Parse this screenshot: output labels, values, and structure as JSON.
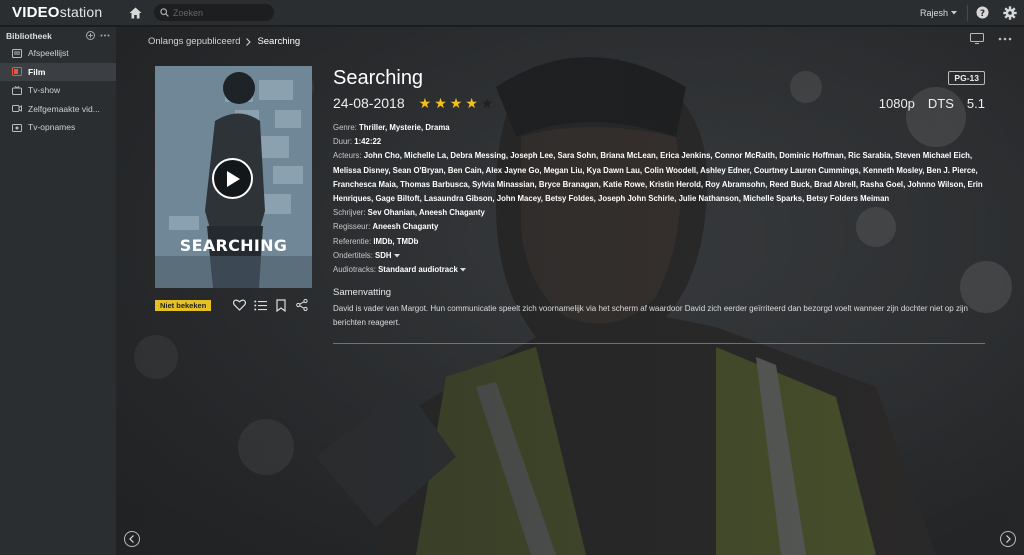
{
  "app": {
    "logo_bold": "VIDEO",
    "logo_rest": "station"
  },
  "topbar": {
    "search_placeholder": "Zoeken",
    "user": "Rajesh"
  },
  "sidebar": {
    "header": "Bibliotheek",
    "items": [
      {
        "label": "Afspeellijst",
        "icon": "playlist-icon",
        "active": false
      },
      {
        "label": "Film",
        "icon": "film-icon",
        "active": true
      },
      {
        "label": "Tv-show",
        "icon": "tv-icon",
        "active": false
      },
      {
        "label": "Zelfgemaakte vid...",
        "icon": "home-video-icon",
        "active": false
      },
      {
        "label": "Tv-opnames",
        "icon": "tv-recording-icon",
        "active": false
      }
    ]
  },
  "breadcrumb": {
    "parent": "Onlangs gepubliceerd",
    "current": "Searching"
  },
  "poster": {
    "title": "SEARCHING"
  },
  "status_badge": "Niet bekeken",
  "movie": {
    "title": "Searching",
    "content_rating": "PG-13",
    "date": "24-08-2018",
    "rating": {
      "value": 4,
      "max": 5
    },
    "resolution": "1080p",
    "audio_format": "DTS",
    "channels": "5.1",
    "genre_label": "Genre:",
    "genre": "Thriller, Mysterie, Drama",
    "duration_label": "Duur:",
    "duration": "1:42:22",
    "actors_label": "Acteurs:",
    "actors": "John Cho, Michelle La, Debra Messing, Joseph Lee, Sara Sohn, Briana McLean, Erica Jenkins, Connor McRaith, Dominic Hoffman, Ric Sarabia, Steven Michael Eich, Melissa Disney, Sean O'Bryan, Ben Cain, Alex Jayne Go, Megan Liu, Kya Dawn Lau, Colin Woodell, Ashley Edner, Courtney Lauren Cummings, Kenneth Mosley, Ben J. Pierce, Franchesca Maia, Thomas Barbusca, Sylvia Minassian, Bryce Branagan, Katie Rowe, Kristin Herold, Roy Abramsohn, Reed Buck, Brad Abrell, Rasha Goel, Johnno Wilson, Erin Henriques, Gage Biltoft, Lasaundra Gibson, John Macey, Betsy Foldes, Joseph John Schirle, Julie Nathanson, Michelle Sparks, Betsy Folders Meiman",
    "writer_label": "Schrijver:",
    "writer": "Sev Ohanian, Aneesh Chaganty",
    "director_label": "Regisseur:",
    "director": "Aneesh Chaganty",
    "reference_label": "Referentie:",
    "reference": "IMDb, TMDb",
    "subtitles_label": "Ondertitels:",
    "subtitles": "SDH",
    "audiotracks_label": "Audiotracks:",
    "audiotracks": "Standaard audiotrack",
    "summary_heading": "Samenvatting",
    "summary": "David is vader van Margot. Hun communicatie speelt zich voornamelijk via het scherm af waardoor David zich eerder geïrriteerd dan bezorgd voelt wanneer zijn dochter niet op zijn berichten reageert."
  },
  "colors": {
    "accent_star": "#f3c21c",
    "badge_yellow": "#e5c124",
    "chrome": "#2b2e31"
  }
}
